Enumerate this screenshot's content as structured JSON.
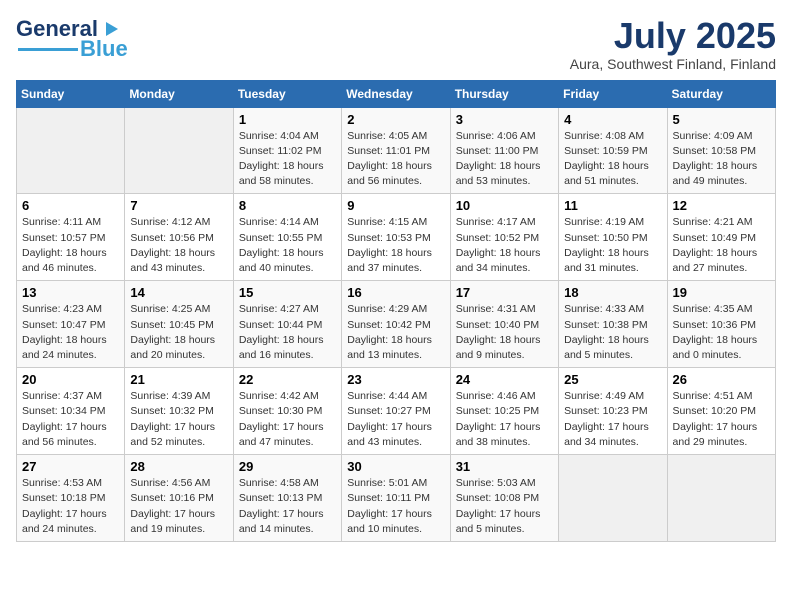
{
  "header": {
    "logo_line1": "General",
    "logo_line2": "Blue",
    "month": "July 2025",
    "location": "Aura, Southwest Finland, Finland"
  },
  "weekdays": [
    "Sunday",
    "Monday",
    "Tuesday",
    "Wednesday",
    "Thursday",
    "Friday",
    "Saturday"
  ],
  "weeks": [
    [
      {
        "day": "",
        "sunrise": "",
        "sunset": "",
        "daylight": ""
      },
      {
        "day": "",
        "sunrise": "",
        "sunset": "",
        "daylight": ""
      },
      {
        "day": "1",
        "sunrise": "Sunrise: 4:04 AM",
        "sunset": "Sunset: 11:02 PM",
        "daylight": "Daylight: 18 hours and 58 minutes."
      },
      {
        "day": "2",
        "sunrise": "Sunrise: 4:05 AM",
        "sunset": "Sunset: 11:01 PM",
        "daylight": "Daylight: 18 hours and 56 minutes."
      },
      {
        "day": "3",
        "sunrise": "Sunrise: 4:06 AM",
        "sunset": "Sunset: 11:00 PM",
        "daylight": "Daylight: 18 hours and 53 minutes."
      },
      {
        "day": "4",
        "sunrise": "Sunrise: 4:08 AM",
        "sunset": "Sunset: 10:59 PM",
        "daylight": "Daylight: 18 hours and 51 minutes."
      },
      {
        "day": "5",
        "sunrise": "Sunrise: 4:09 AM",
        "sunset": "Sunset: 10:58 PM",
        "daylight": "Daylight: 18 hours and 49 minutes."
      }
    ],
    [
      {
        "day": "6",
        "sunrise": "Sunrise: 4:11 AM",
        "sunset": "Sunset: 10:57 PM",
        "daylight": "Daylight: 18 hours and 46 minutes."
      },
      {
        "day": "7",
        "sunrise": "Sunrise: 4:12 AM",
        "sunset": "Sunset: 10:56 PM",
        "daylight": "Daylight: 18 hours and 43 minutes."
      },
      {
        "day": "8",
        "sunrise": "Sunrise: 4:14 AM",
        "sunset": "Sunset: 10:55 PM",
        "daylight": "Daylight: 18 hours and 40 minutes."
      },
      {
        "day": "9",
        "sunrise": "Sunrise: 4:15 AM",
        "sunset": "Sunset: 10:53 PM",
        "daylight": "Daylight: 18 hours and 37 minutes."
      },
      {
        "day": "10",
        "sunrise": "Sunrise: 4:17 AM",
        "sunset": "Sunset: 10:52 PM",
        "daylight": "Daylight: 18 hours and 34 minutes."
      },
      {
        "day": "11",
        "sunrise": "Sunrise: 4:19 AM",
        "sunset": "Sunset: 10:50 PM",
        "daylight": "Daylight: 18 hours and 31 minutes."
      },
      {
        "day": "12",
        "sunrise": "Sunrise: 4:21 AM",
        "sunset": "Sunset: 10:49 PM",
        "daylight": "Daylight: 18 hours and 27 minutes."
      }
    ],
    [
      {
        "day": "13",
        "sunrise": "Sunrise: 4:23 AM",
        "sunset": "Sunset: 10:47 PM",
        "daylight": "Daylight: 18 hours and 24 minutes."
      },
      {
        "day": "14",
        "sunrise": "Sunrise: 4:25 AM",
        "sunset": "Sunset: 10:45 PM",
        "daylight": "Daylight: 18 hours and 20 minutes."
      },
      {
        "day": "15",
        "sunrise": "Sunrise: 4:27 AM",
        "sunset": "Sunset: 10:44 PM",
        "daylight": "Daylight: 18 hours and 16 minutes."
      },
      {
        "day": "16",
        "sunrise": "Sunrise: 4:29 AM",
        "sunset": "Sunset: 10:42 PM",
        "daylight": "Daylight: 18 hours and 13 minutes."
      },
      {
        "day": "17",
        "sunrise": "Sunrise: 4:31 AM",
        "sunset": "Sunset: 10:40 PM",
        "daylight": "Daylight: 18 hours and 9 minutes."
      },
      {
        "day": "18",
        "sunrise": "Sunrise: 4:33 AM",
        "sunset": "Sunset: 10:38 PM",
        "daylight": "Daylight: 18 hours and 5 minutes."
      },
      {
        "day": "19",
        "sunrise": "Sunrise: 4:35 AM",
        "sunset": "Sunset: 10:36 PM",
        "daylight": "Daylight: 18 hours and 0 minutes."
      }
    ],
    [
      {
        "day": "20",
        "sunrise": "Sunrise: 4:37 AM",
        "sunset": "Sunset: 10:34 PM",
        "daylight": "Daylight: 17 hours and 56 minutes."
      },
      {
        "day": "21",
        "sunrise": "Sunrise: 4:39 AM",
        "sunset": "Sunset: 10:32 PM",
        "daylight": "Daylight: 17 hours and 52 minutes."
      },
      {
        "day": "22",
        "sunrise": "Sunrise: 4:42 AM",
        "sunset": "Sunset: 10:30 PM",
        "daylight": "Daylight: 17 hours and 47 minutes."
      },
      {
        "day": "23",
        "sunrise": "Sunrise: 4:44 AM",
        "sunset": "Sunset: 10:27 PM",
        "daylight": "Daylight: 17 hours and 43 minutes."
      },
      {
        "day": "24",
        "sunrise": "Sunrise: 4:46 AM",
        "sunset": "Sunset: 10:25 PM",
        "daylight": "Daylight: 17 hours and 38 minutes."
      },
      {
        "day": "25",
        "sunrise": "Sunrise: 4:49 AM",
        "sunset": "Sunset: 10:23 PM",
        "daylight": "Daylight: 17 hours and 34 minutes."
      },
      {
        "day": "26",
        "sunrise": "Sunrise: 4:51 AM",
        "sunset": "Sunset: 10:20 PM",
        "daylight": "Daylight: 17 hours and 29 minutes."
      }
    ],
    [
      {
        "day": "27",
        "sunrise": "Sunrise: 4:53 AM",
        "sunset": "Sunset: 10:18 PM",
        "daylight": "Daylight: 17 hours and 24 minutes."
      },
      {
        "day": "28",
        "sunrise": "Sunrise: 4:56 AM",
        "sunset": "Sunset: 10:16 PM",
        "daylight": "Daylight: 17 hours and 19 minutes."
      },
      {
        "day": "29",
        "sunrise": "Sunrise: 4:58 AM",
        "sunset": "Sunset: 10:13 PM",
        "daylight": "Daylight: 17 hours and 14 minutes."
      },
      {
        "day": "30",
        "sunrise": "Sunrise: 5:01 AM",
        "sunset": "Sunset: 10:11 PM",
        "daylight": "Daylight: 17 hours and 10 minutes."
      },
      {
        "day": "31",
        "sunrise": "Sunrise: 5:03 AM",
        "sunset": "Sunset: 10:08 PM",
        "daylight": "Daylight: 17 hours and 5 minutes."
      },
      {
        "day": "",
        "sunrise": "",
        "sunset": "",
        "daylight": ""
      },
      {
        "day": "",
        "sunrise": "",
        "sunset": "",
        "daylight": ""
      }
    ]
  ]
}
